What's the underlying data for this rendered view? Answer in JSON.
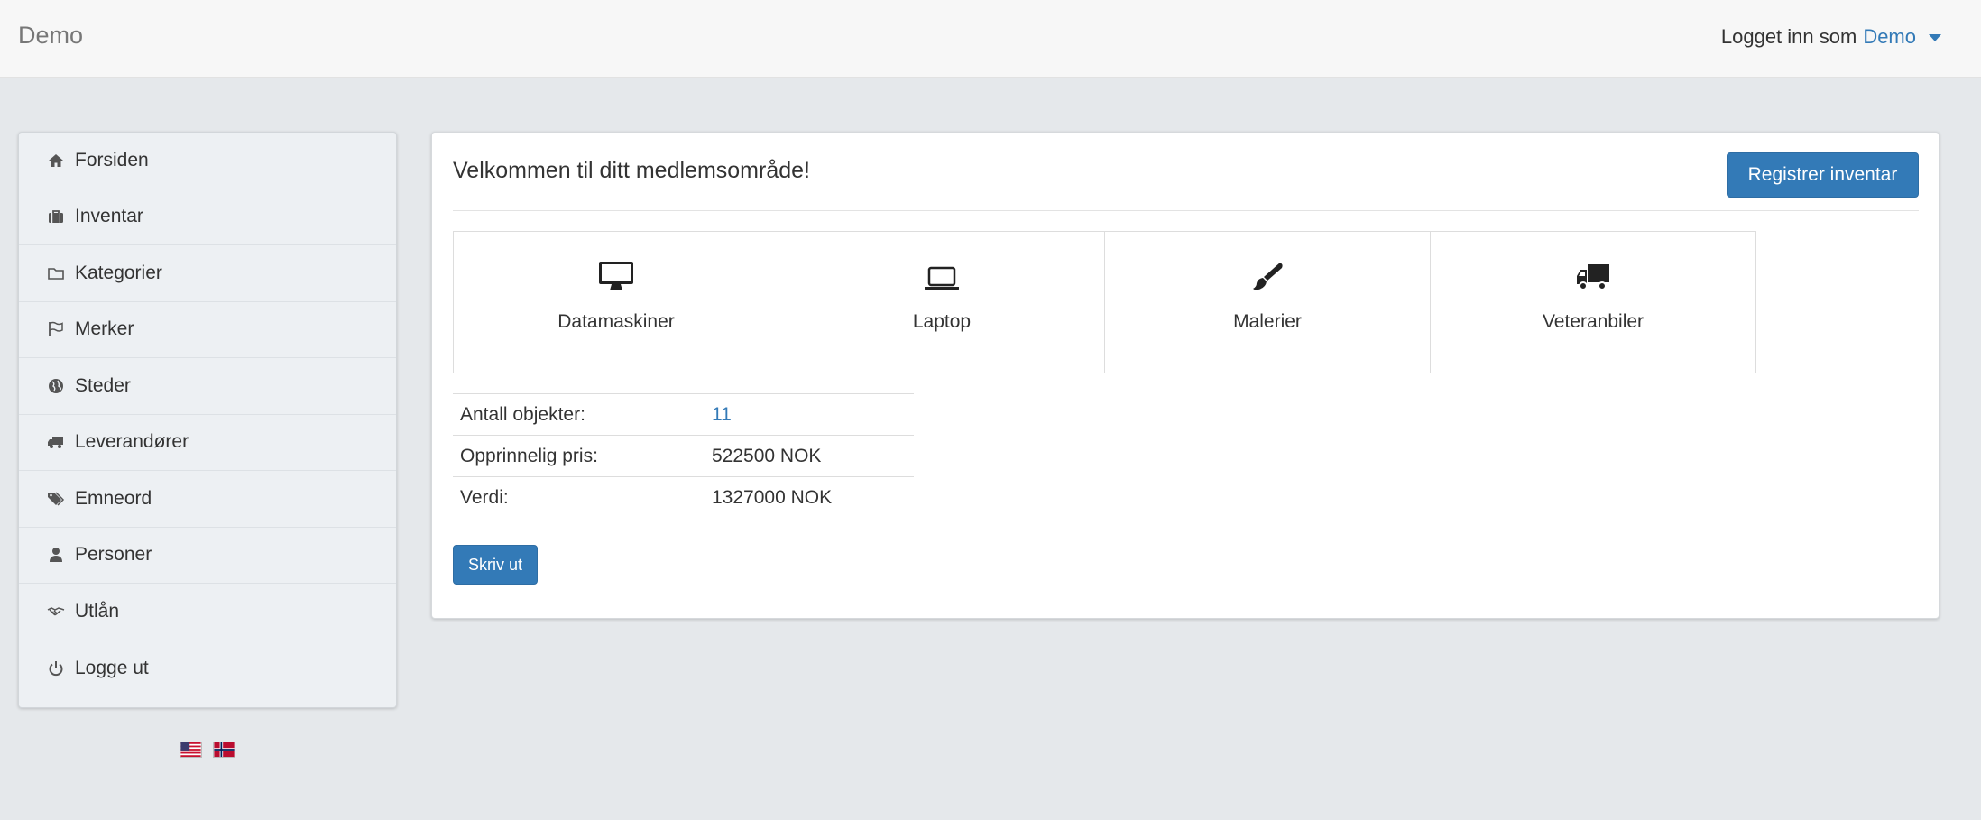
{
  "app": {
    "brand": "Demo"
  },
  "user": {
    "logged_in_as": "Logget inn som",
    "name": "Demo"
  },
  "sidebar": {
    "items": [
      {
        "label": "Forsiden",
        "icon": "home-icon"
      },
      {
        "label": "Inventar",
        "icon": "briefcase-icon"
      },
      {
        "label": "Kategorier",
        "icon": "folder-icon"
      },
      {
        "label": "Merker",
        "icon": "flag-icon"
      },
      {
        "label": "Steder",
        "icon": "globe-icon"
      },
      {
        "label": "Leverandører",
        "icon": "truck-icon"
      },
      {
        "label": "Emneord",
        "icon": "tags-icon"
      },
      {
        "label": "Personer",
        "icon": "user-icon"
      },
      {
        "label": "Utlån",
        "icon": "handshake-icon"
      },
      {
        "label": "Logge ut",
        "icon": "power-icon"
      }
    ]
  },
  "languages": [
    {
      "code": "en",
      "icon": "us-flag-icon"
    },
    {
      "code": "no",
      "icon": "norway-flag-icon"
    }
  ],
  "main": {
    "title": "Velkommen til ditt medlemsområde!",
    "register_button": "Registrer inventar",
    "categories": [
      {
        "label": "Datamaskiner",
        "icon": "desktop-icon"
      },
      {
        "label": "Laptop",
        "icon": "laptop-icon"
      },
      {
        "label": "Malerier",
        "icon": "paintbrush-icon"
      },
      {
        "label": "Veteranbiler",
        "icon": "truck-icon"
      }
    ],
    "stats": [
      {
        "label": "Antall objekter:",
        "value": "11",
        "link": true
      },
      {
        "label": "Opprinnelig pris:",
        "value": "522500 NOK",
        "link": false
      },
      {
        "label": "Verdi:",
        "value": "1327000 NOK",
        "link": false
      }
    ],
    "print_button": "Skriv ut"
  },
  "colors": {
    "accent": "#337ab7",
    "background": "#e5e8eb",
    "navbar": "#f7f7f7"
  }
}
